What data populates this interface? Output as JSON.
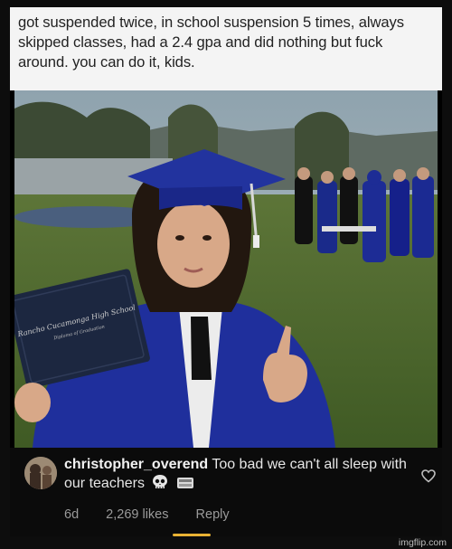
{
  "caption": {
    "text": "got suspended twice, in school suspension 5 times, always skipped classes, had a 2.4 gpa and did nothing but fuck around. you can do it, kids."
  },
  "photo": {
    "diploma_school": "Rancho Cucamonga High School",
    "diploma_subtitle": "Diploma of Graduation",
    "colors": {
      "gown": "#1f2f9c",
      "cap": "#22339e",
      "grass": "#4f6a2e",
      "sky": "#9fb2bd"
    }
  },
  "comment": {
    "username": "christopher_overend",
    "text": "Too bad we can't all sleep with our teachers",
    "emojis": [
      "skull-emoji",
      "keyboard-emoji"
    ],
    "age": "6d",
    "likes": "2,269 likes",
    "reply_label": "Reply",
    "heart_icon": "heart-icon"
  },
  "watermark": "imgflip.com"
}
